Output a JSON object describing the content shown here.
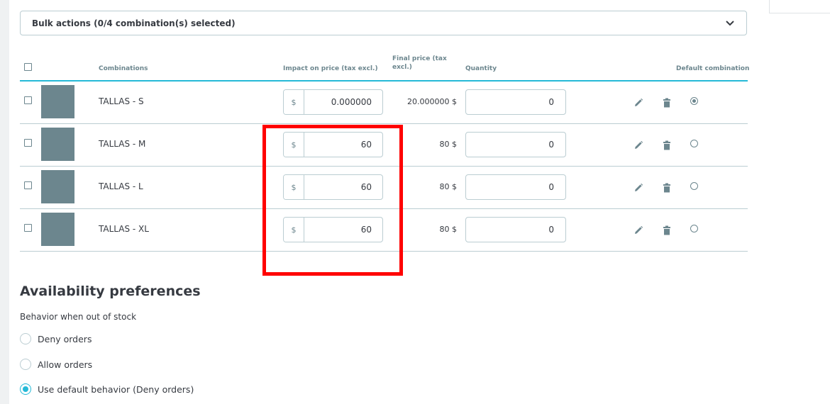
{
  "bulk_actions": {
    "label": "Bulk actions (0/4 combination(s) selected)"
  },
  "table": {
    "headers": {
      "combinations": "Combinations",
      "impact": "Impact on price (tax excl.)",
      "final_line1": "Final price (tax",
      "final_line2": "excl.)",
      "quantity": "Quantity",
      "default": "Default combination"
    },
    "currency": "$",
    "rows": [
      {
        "name": "TALLAS - S",
        "impact": "0.000000",
        "final": "20.000000 $",
        "quantity": "0",
        "default": true
      },
      {
        "name": "TALLAS - M",
        "impact": "60",
        "final": "80 $",
        "quantity": "0",
        "default": false
      },
      {
        "name": "TALLAS - L",
        "impact": "60",
        "final": "80 $",
        "quantity": "0",
        "default": false
      },
      {
        "name": "TALLAS - XL",
        "impact": "60",
        "final": "80 $",
        "quantity": "0",
        "default": false
      }
    ]
  },
  "availability": {
    "title": "Availability preferences",
    "behavior_label": "Behavior when out of stock",
    "options": [
      {
        "label": "Deny orders",
        "selected": false
      },
      {
        "label": "Allow orders",
        "selected": false
      },
      {
        "label": "Use default behavior (Deny orders)",
        "selected": true
      }
    ]
  },
  "colors": {
    "accent": "#25b9d7",
    "highlight": "#ff0000",
    "thumbnail": "#6c868e"
  },
  "icons": [
    "chevron-down-icon",
    "pencil-icon",
    "trash-icon"
  ]
}
